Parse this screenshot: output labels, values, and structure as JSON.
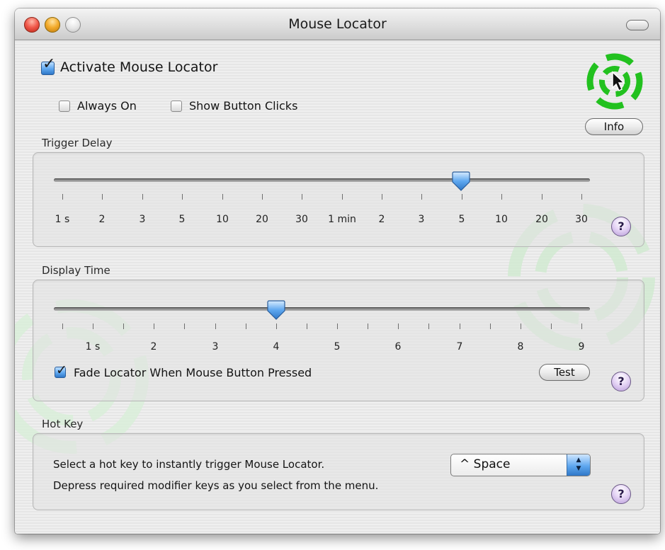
{
  "window": {
    "title": "Mouse Locator"
  },
  "main": {
    "activate_label": "Activate Mouse Locator",
    "activate_checked": true,
    "always_on_label": "Always On",
    "always_on_checked": false,
    "show_clicks_label": "Show Button Clicks",
    "show_clicks_checked": false,
    "info_button": "Info"
  },
  "trigger_delay": {
    "title": "Trigger Delay",
    "ticks": [
      "1 s",
      "2",
      "3",
      "5",
      "10",
      "20",
      "30",
      "1 min",
      "2",
      "3",
      "5",
      "10",
      "20",
      "30"
    ],
    "selected": "5",
    "selected_index": 10,
    "help": "?"
  },
  "display_time": {
    "title": "Display Time",
    "ticks": [
      "1 s",
      "2",
      "3",
      "4",
      "5",
      "6",
      "7",
      "8",
      "9"
    ],
    "value": 4,
    "min": 1,
    "max": 9,
    "fade_label": "Fade Locator When Mouse Button Pressed",
    "fade_checked": true,
    "test_button": "Test",
    "help": "?"
  },
  "hot_key": {
    "title": "Hot Key",
    "line1": "Select a hot key to instantly trigger Mouse Locator.",
    "line2": "Depress required modifier keys as you select from the menu.",
    "selected": "^ Space",
    "help": "?"
  },
  "colors": {
    "accent_blue": "#5ea7ef",
    "locator_green": "#22c11f",
    "help_purple": "#b79ad8"
  },
  "icons": {
    "locator": "mouse-locator-target-icon",
    "close": "close-icon",
    "minimize": "minimize-icon",
    "zoom": "zoom-icon",
    "toolbar": "toolbar-toggle-icon",
    "help": "help-icon",
    "popup_arrows": "updown-arrows-icon"
  }
}
